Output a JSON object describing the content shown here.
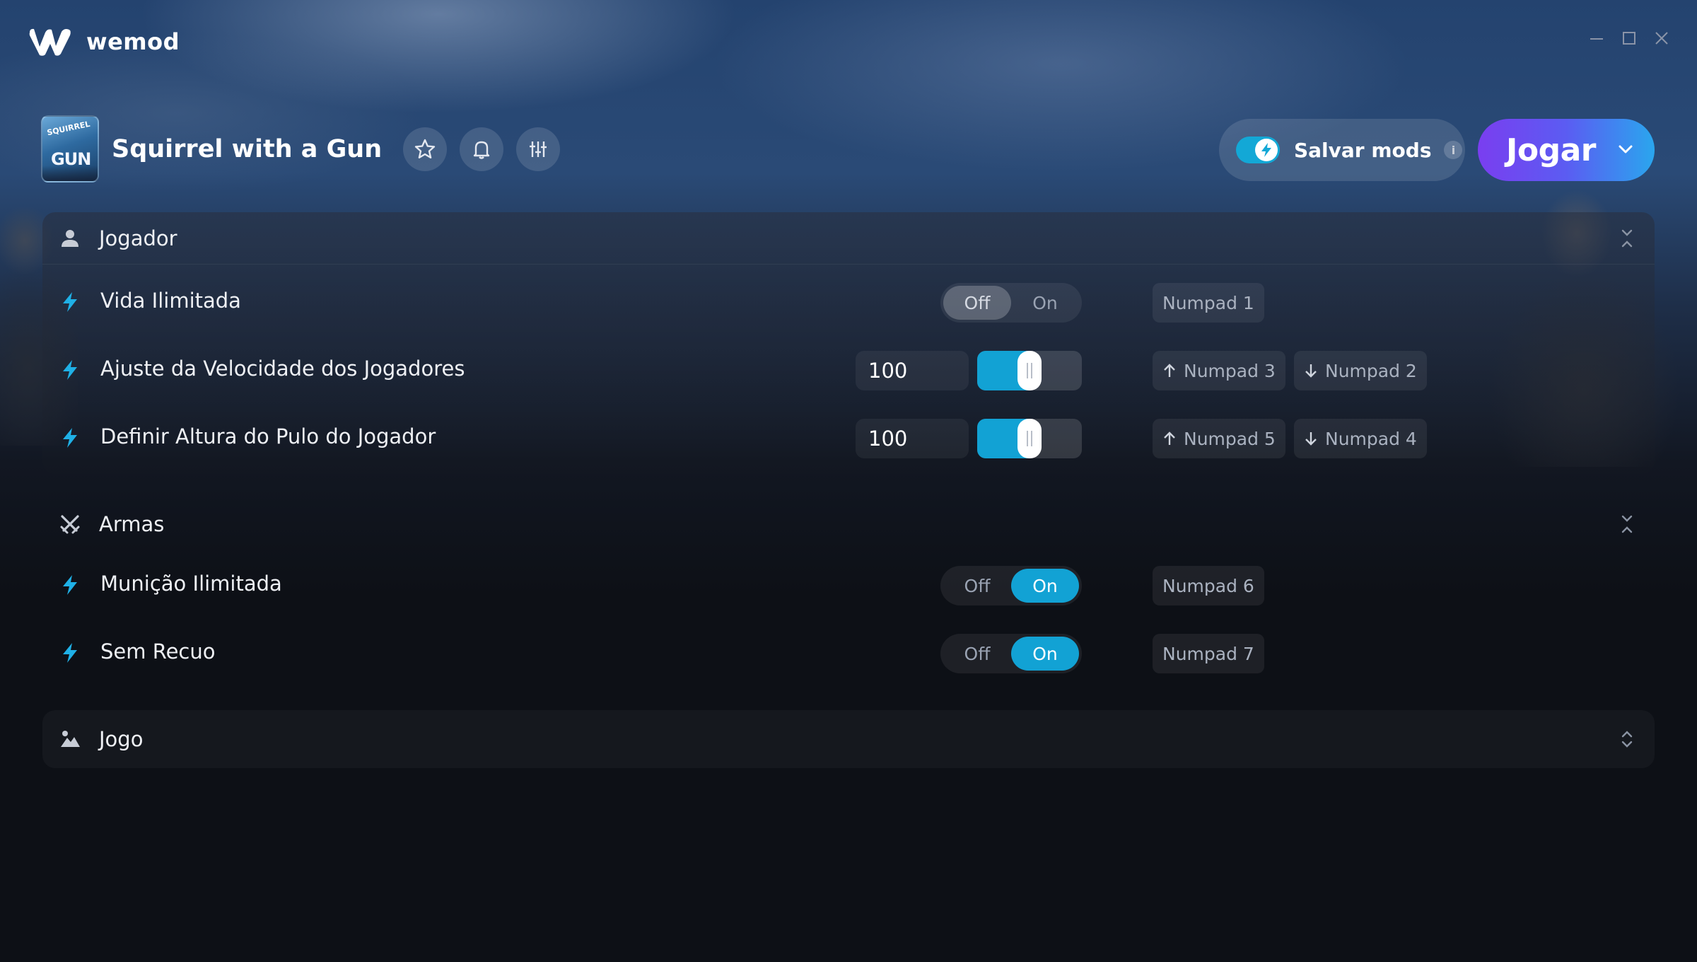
{
  "app": {
    "logo_text": "wemod"
  },
  "game": {
    "title": "Squirrel with a Gun",
    "thumb_line1": "SQUIRREL",
    "thumb_line2": "GUN"
  },
  "header": {
    "save_mods_label": "Salvar mods",
    "save_mods_info": "i",
    "play_label": "Jogar"
  },
  "colors": {
    "accent": "#12a2d4",
    "play_gradient_start": "#7a3ef0",
    "play_gradient_end": "#2aa6ee",
    "bolt": "#1fb0e6"
  },
  "toggle_labels": {
    "off": "Off",
    "on": "On"
  },
  "sections": [
    {
      "label": "Jogador",
      "icon": "user-icon",
      "expanded": true,
      "mods": [
        {
          "label": "Vida Ilimitada",
          "type": "toggle",
          "value": "Off",
          "keys": [
            "Numpad 1"
          ]
        },
        {
          "label": "Ajuste da Velocidade dos Jogadores",
          "type": "slider",
          "value": "100",
          "level": 0.5,
          "keys": [
            "Numpad 3",
            "Numpad 2"
          ]
        },
        {
          "label": "Definir Altura do Pulo do Jogador",
          "type": "slider",
          "value": "100",
          "level": 0.5,
          "keys": [
            "Numpad 5",
            "Numpad 4"
          ]
        }
      ]
    },
    {
      "label": "Armas",
      "icon": "crossed-swords-icon",
      "expanded": true,
      "mods": [
        {
          "label": "Munição Ilimitada",
          "type": "toggle",
          "value": "On",
          "keys": [
            "Numpad 6"
          ]
        },
        {
          "label": "Sem Recuo",
          "type": "toggle",
          "value": "On",
          "keys": [
            "Numpad 7"
          ]
        }
      ]
    },
    {
      "label": "Jogo",
      "icon": "landscape-icon",
      "expanded": false
    }
  ]
}
